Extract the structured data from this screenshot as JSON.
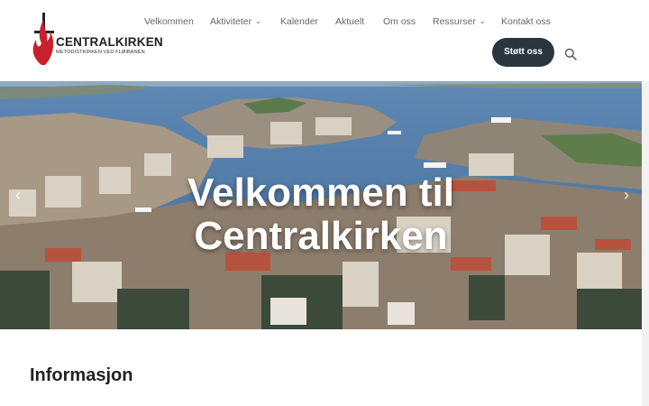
{
  "header": {
    "logo": {
      "name": "CENTRALKIRKEN",
      "subtitle": "METODISTKIRKEN VED FLØIBANEN"
    },
    "nav": [
      {
        "label": "Velkommen",
        "has_dropdown": false
      },
      {
        "label": "Aktiviteter",
        "has_dropdown": true
      },
      {
        "label": "Kalender",
        "has_dropdown": false
      },
      {
        "label": "Aktuelt",
        "has_dropdown": false
      },
      {
        "label": "Om oss",
        "has_dropdown": false
      },
      {
        "label": "Ressurser",
        "has_dropdown": true
      },
      {
        "label": "Kontakt oss",
        "has_dropdown": false
      }
    ],
    "support_button": "Støtt oss",
    "search_icon": "search-icon"
  },
  "hero": {
    "title_line1": "Velkommen til",
    "title_line2": "Centralkirken",
    "prev_icon": "chevron-left-icon",
    "next_icon": "chevron-right-icon"
  },
  "main": {
    "section_title": "Informasjon"
  },
  "colors": {
    "button_bg": "#2b3540",
    "logo_red": "#c8202f",
    "nav_text": "#666666"
  }
}
